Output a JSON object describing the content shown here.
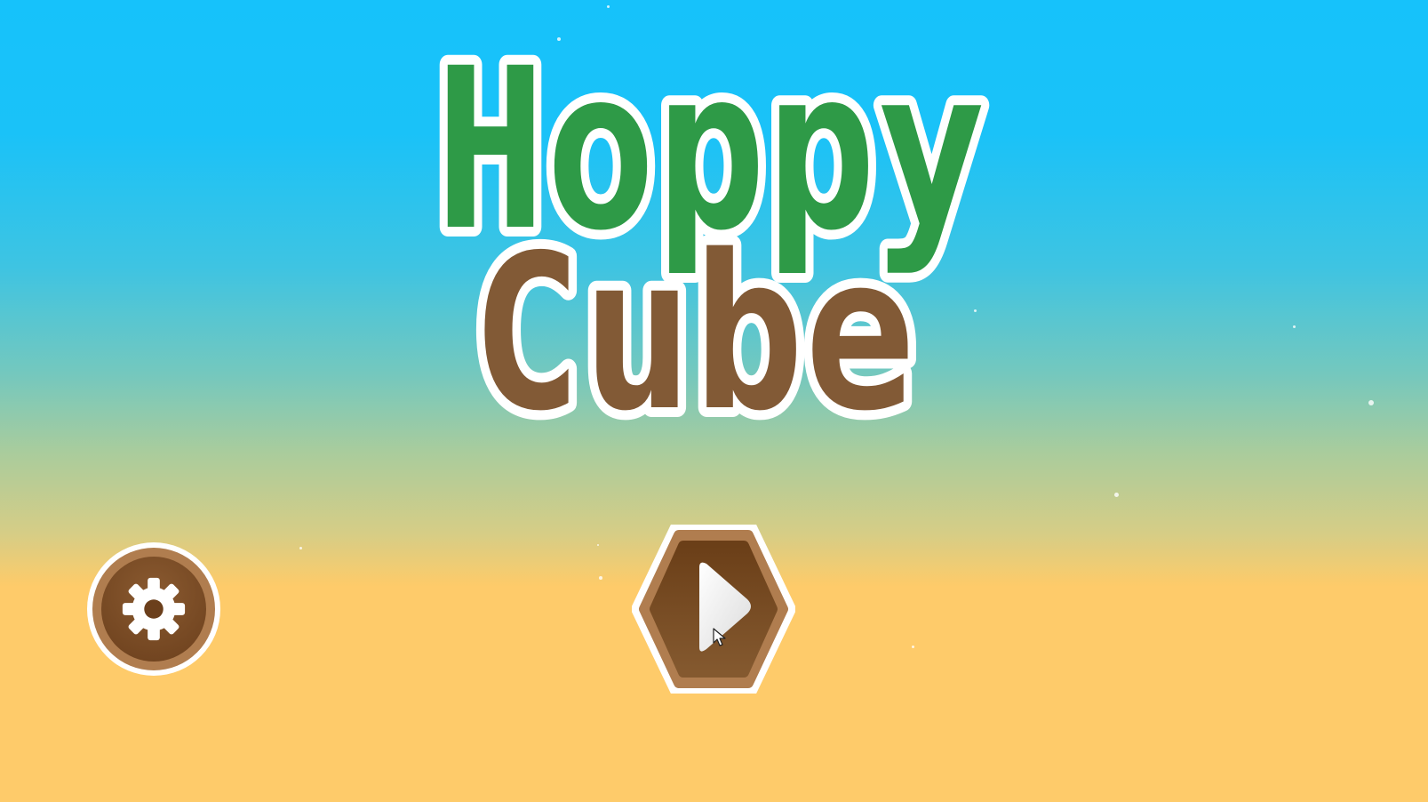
{
  "game": {
    "title_line1": "Hoppy",
    "title_line2": "Cube"
  },
  "icons": {
    "settings": "gear-icon",
    "play": "play-icon",
    "cursor": "mouse-pointer-icon"
  },
  "colors": {
    "sky_top": "#16c2fb",
    "sand": "#fecb6a",
    "title_green": "#2e9a47",
    "title_brown": "#825a36",
    "button_brown": "#6b3f1c",
    "button_ring": "#b07d4f"
  }
}
